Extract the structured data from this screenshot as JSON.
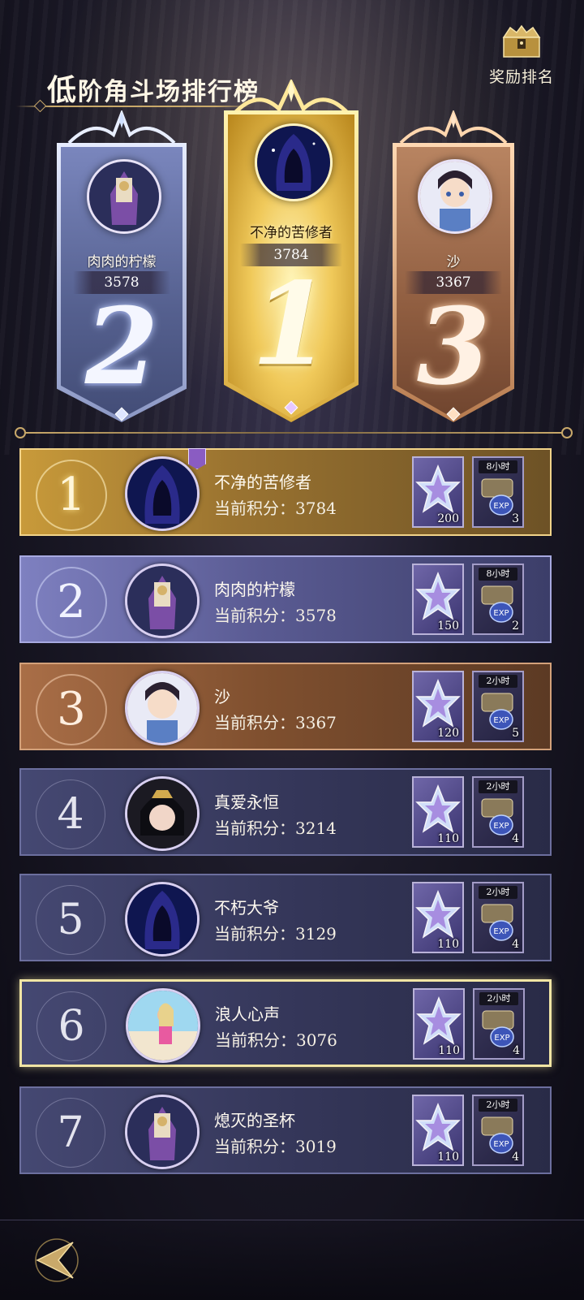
{
  "header": {
    "title_first": "低",
    "title_rest": "阶角斗场排行榜",
    "reward_label": "奖励排名"
  },
  "podium": [
    {
      "rank": "2",
      "name": "肉肉的柠檬",
      "score": "3578"
    },
    {
      "rank": "1",
      "name": "不净的苦修者",
      "score": "3784"
    },
    {
      "rank": "3",
      "name": "沙",
      "score": "3367"
    }
  ],
  "rows": [
    {
      "rank": "1",
      "name": "不净的苦修者",
      "score": "当前积分：3784",
      "gem_count": "200",
      "exp_time": "8小时",
      "exp_count": "3"
    },
    {
      "rank": "2",
      "name": "肉肉的柠檬",
      "score": "当前积分：3578",
      "gem_count": "150",
      "exp_time": "8小时",
      "exp_count": "2"
    },
    {
      "rank": "3",
      "name": "沙",
      "score": "当前积分：3367",
      "gem_count": "120",
      "exp_time": "2小时",
      "exp_count": "5"
    },
    {
      "rank": "4",
      "name": "真爱永恒",
      "score": "当前积分：3214",
      "gem_count": "110",
      "exp_time": "2小时",
      "exp_count": "4"
    },
    {
      "rank": "5",
      "name": "不朽大爷",
      "score": "当前积分：3129",
      "gem_count": "110",
      "exp_time": "2小时",
      "exp_count": "4"
    },
    {
      "rank": "6",
      "name": "浪人心声",
      "score": "当前积分：3076",
      "gem_count": "110",
      "exp_time": "2小时",
      "exp_count": "4"
    },
    {
      "rank": "7",
      "name": "熄灭的圣杯",
      "score": "当前积分：3019",
      "gem_count": "110",
      "exp_time": "2小时",
      "exp_count": "4"
    }
  ],
  "exp_label": "EXP",
  "icons": {
    "reward": "treasure-chest-icon",
    "back": "back-arrow-icon",
    "gem": "star-crystal-icon",
    "exp": "exp-potion-icon"
  },
  "colors": {
    "gold": "#c9a96a",
    "first": "#f0c95a",
    "second": "#7a86bd",
    "third": "#b88461",
    "row_default": "#35375a",
    "selected_border": "#f1e5a4"
  }
}
